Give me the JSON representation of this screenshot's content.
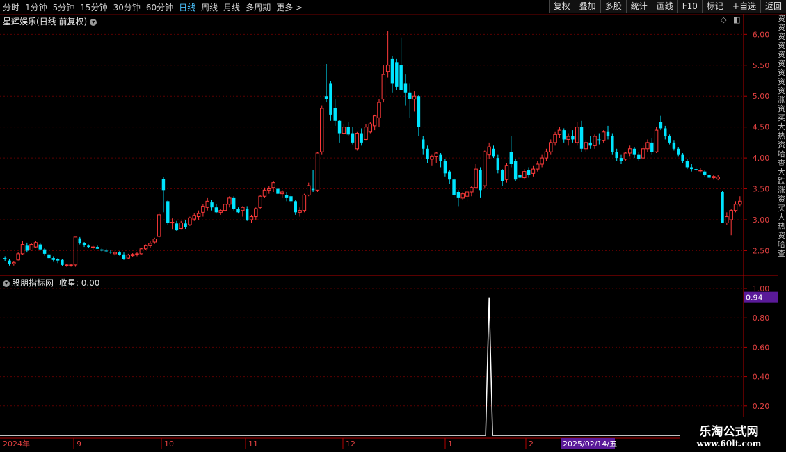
{
  "toolbar": {
    "periods": [
      "分时",
      "1分钟",
      "5分钟",
      "15分钟",
      "30分钟",
      "60分钟",
      "日线",
      "周线",
      "月线",
      "多周期",
      "更多 >"
    ],
    "active_period": "日线",
    "buttons": [
      "复权",
      "叠加",
      "多股",
      "统计",
      "画线",
      "F10",
      "标记",
      "+自选",
      "返回"
    ]
  },
  "stock": {
    "name": "星辉娱乐",
    "mode": "(日线 前复权)"
  },
  "indicator": {
    "name": "股朋指标网",
    "label": "收星:",
    "value": "0.00",
    "current_value_badge": "0.94"
  },
  "colors": {
    "up": "#ff3a3a",
    "down": "#00e5ff",
    "grid": "#5a0000",
    "axis": "#b20000",
    "badge": "#5a1a99"
  },
  "date_axis": {
    "year_label": "2024年",
    "months": [
      "9",
      "10",
      "11",
      "12",
      "1",
      "2"
    ],
    "cursor_date": "2025/02/14/五"
  },
  "watermark": {
    "line1": "乐淘公式网",
    "line2": "www.60lt.com"
  },
  "right_strip_text": "资资资资资资资资资涨资买大热资哈查大跌涨资买大热资哈查",
  "chart_data": [
    {
      "type": "candlestick",
      "title": "星辉娱乐 (日线 前复权)",
      "ylim": [
        2.1,
        6.15
      ],
      "y_ticks": [
        "6.00",
        "5.50",
        "5.00",
        "4.50",
        "4.00",
        "3.50",
        "3.00",
        "2.50"
      ],
      "x_months": [
        "2024年",
        "9",
        "10",
        "11",
        "12",
        "1",
        "2"
      ],
      "candles": [
        [
          2.38,
          2.41,
          2.33,
          2.36
        ],
        [
          2.34,
          2.36,
          2.26,
          2.28
        ],
        [
          2.29,
          2.33,
          2.26,
          2.31
        ],
        [
          2.35,
          2.48,
          2.34,
          2.45
        ],
        [
          2.45,
          2.66,
          2.43,
          2.6
        ],
        [
          2.58,
          2.63,
          2.47,
          2.5
        ],
        [
          2.51,
          2.62,
          2.5,
          2.6
        ],
        [
          2.56,
          2.66,
          2.54,
          2.63
        ],
        [
          2.6,
          2.63,
          2.5,
          2.52
        ],
        [
          2.52,
          2.55,
          2.42,
          2.45
        ],
        [
          2.44,
          2.46,
          2.36,
          2.38
        ],
        [
          2.38,
          2.41,
          2.32,
          2.35
        ],
        [
          2.36,
          2.38,
          2.3,
          2.34
        ],
        [
          2.35,
          2.37,
          2.25,
          2.27
        ],
        [
          2.27,
          2.29,
          2.24,
          2.27
        ],
        [
          2.26,
          2.29,
          2.24,
          2.27
        ],
        [
          2.27,
          2.72,
          2.24,
          2.72
        ],
        [
          2.7,
          2.72,
          2.6,
          2.62
        ],
        [
          2.62,
          2.64,
          2.56,
          2.59
        ],
        [
          2.58,
          2.6,
          2.54,
          2.56
        ],
        [
          2.55,
          2.58,
          2.52,
          2.56
        ],
        [
          2.56,
          2.58,
          2.53,
          2.53
        ],
        [
          2.52,
          2.54,
          2.48,
          2.5
        ],
        [
          2.5,
          2.53,
          2.47,
          2.49
        ],
        [
          2.48,
          2.51,
          2.45,
          2.47
        ],
        [
          2.45,
          2.5,
          2.42,
          2.47
        ],
        [
          2.47,
          2.49,
          2.42,
          2.43
        ],
        [
          2.44,
          2.47,
          2.35,
          2.37
        ],
        [
          2.38,
          2.45,
          2.36,
          2.43
        ],
        [
          2.42,
          2.46,
          2.4,
          2.44
        ],
        [
          2.44,
          2.48,
          2.41,
          2.45
        ],
        [
          2.45,
          2.55,
          2.44,
          2.53
        ],
        [
          2.53,
          2.6,
          2.51,
          2.58
        ],
        [
          2.58,
          2.65,
          2.55,
          2.62
        ],
        [
          2.64,
          2.71,
          2.61,
          2.69
        ],
        [
          2.73,
          3.12,
          2.71,
          3.08
        ],
        [
          3.66,
          3.69,
          3.12,
          3.48
        ],
        [
          3.3,
          3.32,
          2.92,
          2.95
        ],
        [
          2.95,
          3.02,
          2.84,
          2.96
        ],
        [
          2.94,
          2.98,
          2.82,
          2.83
        ],
        [
          2.86,
          2.98,
          2.84,
          2.95
        ],
        [
          2.94,
          3.0,
          2.85,
          2.88
        ],
        [
          2.92,
          3.05,
          2.9,
          3.03
        ],
        [
          3.01,
          3.1,
          2.98,
          3.07
        ],
        [
          3.05,
          3.15,
          3.0,
          3.1
        ],
        [
          3.12,
          3.25,
          3.05,
          3.22
        ],
        [
          3.2,
          3.35,
          3.15,
          3.3
        ],
        [
          3.28,
          3.32,
          3.15,
          3.2
        ],
        [
          3.2,
          3.25,
          3.1,
          3.12
        ],
        [
          3.12,
          3.18,
          3.08,
          3.15
        ],
        [
          3.15,
          3.28,
          3.12,
          3.25
        ],
        [
          3.25,
          3.38,
          3.2,
          3.35
        ],
        [
          3.35,
          3.38,
          3.15,
          3.18
        ],
        [
          3.18,
          3.2,
          3.1,
          3.12
        ],
        [
          3.15,
          3.22,
          3.05,
          3.2
        ],
        [
          3.18,
          3.22,
          2.98,
          3.0
        ],
        [
          3.0,
          3.08,
          2.95,
          3.05
        ],
        [
          3.05,
          3.2,
          3.0,
          3.18
        ],
        [
          3.2,
          3.4,
          3.18,
          3.38
        ],
        [
          3.38,
          3.52,
          3.35,
          3.48
        ],
        [
          3.48,
          3.55,
          3.42,
          3.5
        ],
        [
          3.52,
          3.62,
          3.45,
          3.6
        ],
        [
          3.5,
          3.52,
          3.4,
          3.42
        ],
        [
          3.42,
          3.48,
          3.35,
          3.45
        ],
        [
          3.4,
          3.45,
          3.3,
          3.35
        ],
        [
          3.38,
          3.42,
          3.25,
          3.3
        ],
        [
          3.3,
          3.32,
          3.08,
          3.12
        ],
        [
          3.12,
          3.2,
          3.05,
          3.15
        ],
        [
          3.15,
          3.42,
          3.12,
          3.4
        ],
        [
          3.4,
          3.6,
          3.38,
          3.55
        ],
        [
          3.5,
          3.8,
          3.45,
          3.48
        ],
        [
          3.48,
          4.1,
          3.45,
          4.08
        ],
        [
          4.1,
          4.85,
          4.05,
          4.8
        ],
        [
          5.0,
          5.52,
          4.9,
          4.95
        ],
        [
          5.2,
          5.25,
          4.6,
          4.7
        ],
        [
          4.8,
          4.95,
          4.52,
          4.6
        ],
        [
          4.6,
          4.62,
          4.25,
          4.4
        ],
        [
          4.4,
          4.55,
          4.38,
          4.5
        ],
        [
          4.5,
          4.58,
          4.35,
          4.38
        ],
        [
          4.4,
          4.5,
          4.22,
          4.25
        ],
        [
          4.15,
          4.42,
          4.12,
          4.4
        ],
        [
          4.4,
          4.48,
          4.2,
          4.25
        ],
        [
          4.3,
          4.55,
          4.28,
          4.5
        ],
        [
          4.42,
          4.58,
          4.4,
          4.55
        ],
        [
          4.52,
          4.7,
          4.45,
          4.68
        ],
        [
          4.65,
          4.95,
          4.5,
          4.9
        ],
        [
          4.95,
          5.5,
          4.9,
          5.35
        ],
        [
          5.4,
          6.05,
          5.3,
          5.5
        ],
        [
          5.6,
          5.65,
          5.05,
          5.2
        ],
        [
          5.55,
          5.6,
          5.1,
          5.15
        ],
        [
          5.5,
          5.95,
          5.1,
          5.1
        ],
        [
          5.2,
          5.35,
          4.85,
          5.05
        ],
        [
          5.05,
          5.2,
          4.65,
          4.95
        ],
        [
          4.95,
          5.08,
          4.75,
          5.0
        ],
        [
          5.0,
          5.02,
          4.35,
          4.5
        ],
        [
          4.3,
          4.35,
          4.05,
          4.15
        ],
        [
          4.15,
          4.2,
          3.92,
          3.98
        ],
        [
          3.98,
          4.05,
          3.88,
          4.02
        ],
        [
          4.02,
          4.1,
          3.92,
          4.08
        ],
        [
          4.05,
          4.08,
          3.85,
          3.95
        ],
        [
          3.95,
          3.98,
          3.7,
          3.75
        ],
        [
          3.78,
          3.8,
          3.58,
          3.65
        ],
        [
          3.65,
          3.68,
          3.35,
          3.4
        ],
        [
          3.45,
          3.48,
          3.22,
          3.35
        ],
        [
          3.35,
          3.45,
          3.32,
          3.42
        ],
        [
          3.38,
          3.48,
          3.3,
          3.45
        ],
        [
          3.45,
          3.55,
          3.38,
          3.52
        ],
        [
          3.52,
          3.9,
          3.5,
          3.82
        ],
        [
          3.8,
          3.85,
          3.35,
          3.48
        ],
        [
          3.55,
          4.12,
          3.52,
          4.1
        ],
        [
          4.05,
          4.25,
          3.98,
          4.18
        ],
        [
          4.15,
          4.2,
          4.0,
          4.02
        ],
        [
          4.0,
          4.05,
          3.75,
          3.8
        ],
        [
          3.8,
          3.82,
          3.55,
          3.62
        ],
        [
          3.65,
          3.92,
          3.6,
          3.88
        ],
        [
          4.1,
          4.35,
          3.85,
          3.9
        ],
        [
          3.95,
          3.98,
          3.62,
          3.65
        ],
        [
          3.72,
          3.78,
          3.62,
          3.68
        ],
        [
          3.68,
          3.82,
          3.65,
          3.78
        ],
        [
          3.8,
          3.85,
          3.68,
          3.72
        ],
        [
          3.75,
          3.88,
          3.7,
          3.82
        ],
        [
          3.82,
          3.95,
          3.78,
          3.9
        ],
        [
          3.9,
          4.05,
          3.85,
          4.0
        ],
        [
          4.0,
          4.15,
          3.95,
          4.1
        ],
        [
          4.1,
          4.3,
          4.05,
          4.25
        ],
        [
          4.25,
          4.42,
          4.2,
          4.38
        ],
        [
          4.38,
          4.5,
          4.32,
          4.45
        ],
        [
          4.45,
          4.48,
          4.25,
          4.3
        ],
        [
          4.3,
          4.4,
          4.2,
          4.35
        ],
        [
          4.35,
          4.45,
          4.25,
          4.3
        ],
        [
          4.25,
          4.58,
          4.2,
          4.5
        ],
        [
          4.5,
          4.6,
          4.1,
          4.15
        ],
        [
          4.15,
          4.28,
          4.1,
          4.25
        ],
        [
          4.25,
          4.35,
          4.15,
          4.2
        ],
        [
          4.2,
          4.38,
          4.15,
          4.35
        ],
        [
          4.3,
          4.4,
          4.22,
          4.28
        ],
        [
          4.28,
          4.45,
          4.25,
          4.42
        ],
        [
          4.42,
          4.52,
          4.3,
          4.35
        ],
        [
          4.35,
          4.4,
          4.05,
          4.1
        ],
        [
          4.1,
          4.15,
          3.95,
          4.0
        ],
        [
          4.0,
          4.05,
          3.9,
          3.95
        ],
        [
          3.98,
          4.1,
          3.95,
          4.08
        ],
        [
          4.08,
          4.2,
          4.02,
          4.15
        ],
        [
          4.15,
          4.18,
          4.0,
          4.05
        ],
        [
          4.05,
          4.1,
          3.95,
          3.98
        ],
        [
          4.0,
          4.2,
          3.98,
          4.15
        ],
        [
          4.15,
          4.3,
          4.1,
          4.25
        ],
        [
          4.25,
          4.32,
          4.05,
          4.1
        ],
        [
          4.1,
          4.5,
          4.08,
          4.45
        ],
        [
          4.58,
          4.68,
          4.45,
          4.48
        ],
        [
          4.48,
          4.52,
          4.3,
          4.35
        ],
        [
          4.35,
          4.38,
          4.22,
          4.25
        ],
        [
          4.25,
          4.28,
          4.12,
          4.15
        ],
        [
          4.15,
          4.18,
          4.02,
          4.05
        ],
        [
          4.05,
          4.08,
          3.92,
          3.95
        ],
        [
          3.95,
          3.98,
          3.82,
          3.85
        ],
        [
          3.85,
          3.9,
          3.78,
          3.82
        ],
        [
          3.82,
          3.86,
          3.78,
          3.8
        ],
        [
          3.8,
          3.84,
          3.76,
          3.8
        ],
        [
          3.78,
          3.8,
          3.7,
          3.72
        ],
        [
          3.72,
          3.74,
          3.66,
          3.68
        ],
        [
          3.68,
          3.72,
          3.65,
          3.7
        ],
        [
          3.66,
          3.72,
          3.64,
          3.69
        ],
        [
          3.45,
          3.47,
          2.95,
          2.95
        ],
        [
          2.95,
          3.12,
          2.92,
          3.05
        ],
        [
          3.0,
          3.18,
          2.75,
          3.15
        ],
        [
          3.15,
          3.3,
          3.12,
          3.25
        ],
        [
          3.25,
          3.38,
          3.22,
          3.3
        ]
      ]
    },
    {
      "type": "line",
      "title": "股朋指标网 收星",
      "ylim": [
        0,
        1.0
      ],
      "y_ticks": [
        "1.00",
        "0.80",
        "0.60",
        "0.40",
        "0.20"
      ],
      "series": [
        {
          "name": "收星",
          "values_note": "all 0.00 except a single spike",
          "spike_index": 110,
          "spike_value": 0.94,
          "current_value": 0.0
        }
      ]
    }
  ]
}
